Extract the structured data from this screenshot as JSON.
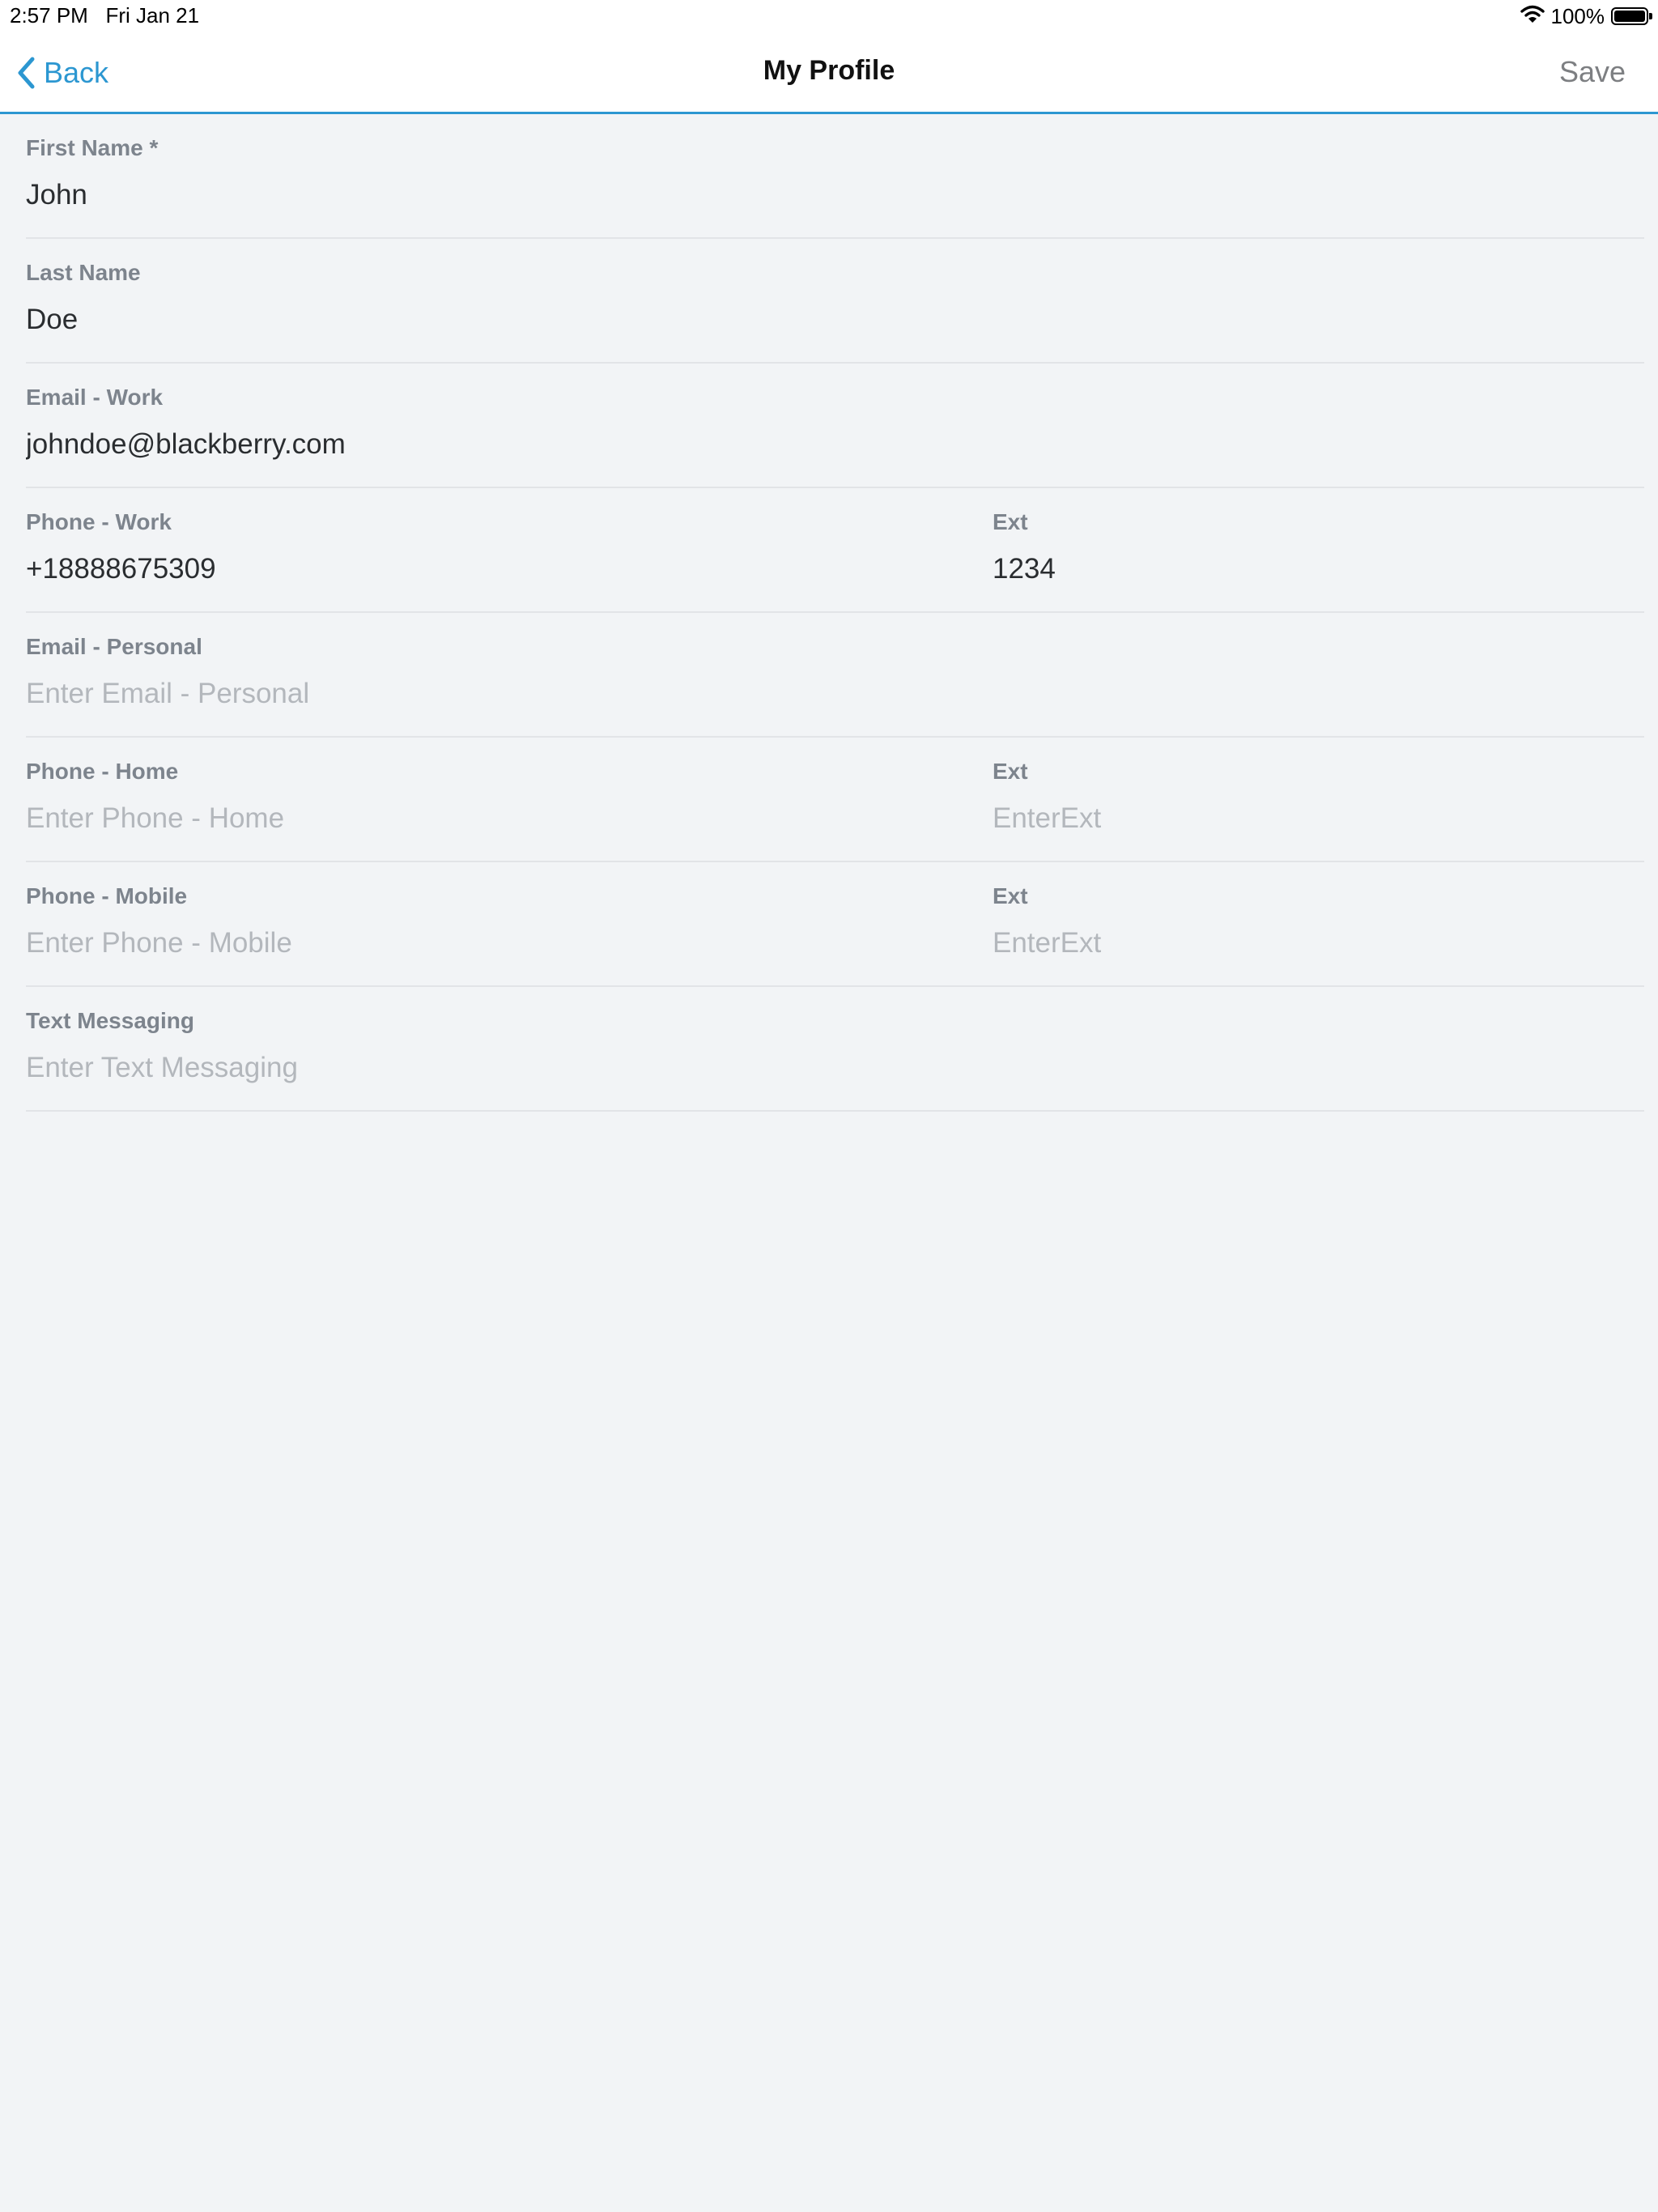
{
  "status_bar": {
    "time": "2:57 PM",
    "date": "Fri Jan 21",
    "battery_percent": "100%",
    "battery_level": 1.0,
    "icons": [
      "wifi-icon",
      "battery-icon"
    ]
  },
  "nav": {
    "back_label": "Back",
    "back_icon": "chevron-left-icon",
    "title": "My Profile",
    "save_label": "Save"
  },
  "colors": {
    "accent": "#2c97d1",
    "background": "#f2f4f6",
    "label": "#7d848d",
    "placeholder": "#b3b7bc",
    "save_disabled": "#7d7f82"
  },
  "fields": {
    "first_name": {
      "label": "First Name *",
      "value": "John",
      "placeholder": ""
    },
    "last_name": {
      "label": "Last Name",
      "value": "Doe",
      "placeholder": ""
    },
    "email_work": {
      "label": "Email - Work",
      "value": "johndoe@blackberry.com",
      "placeholder": ""
    },
    "phone_work": {
      "label": "Phone - Work",
      "value": "+18888675309",
      "placeholder": ""
    },
    "phone_work_ext": {
      "label": "Ext",
      "value": "1234",
      "placeholder": ""
    },
    "email_personal": {
      "label": "Email - Personal",
      "value": "",
      "placeholder": "Enter Email - Personal"
    },
    "phone_home": {
      "label": "Phone - Home",
      "value": "",
      "placeholder": "Enter Phone - Home"
    },
    "phone_home_ext": {
      "label": "Ext",
      "value": "",
      "placeholder": "EnterExt"
    },
    "phone_mobile": {
      "label": "Phone - Mobile",
      "value": "",
      "placeholder": "Enter Phone - Mobile"
    },
    "phone_mobile_ext": {
      "label": "Ext",
      "value": "",
      "placeholder": "EnterExt"
    },
    "text_messaging": {
      "label": "Text Messaging",
      "value": "",
      "placeholder": "Enter Text Messaging"
    }
  }
}
